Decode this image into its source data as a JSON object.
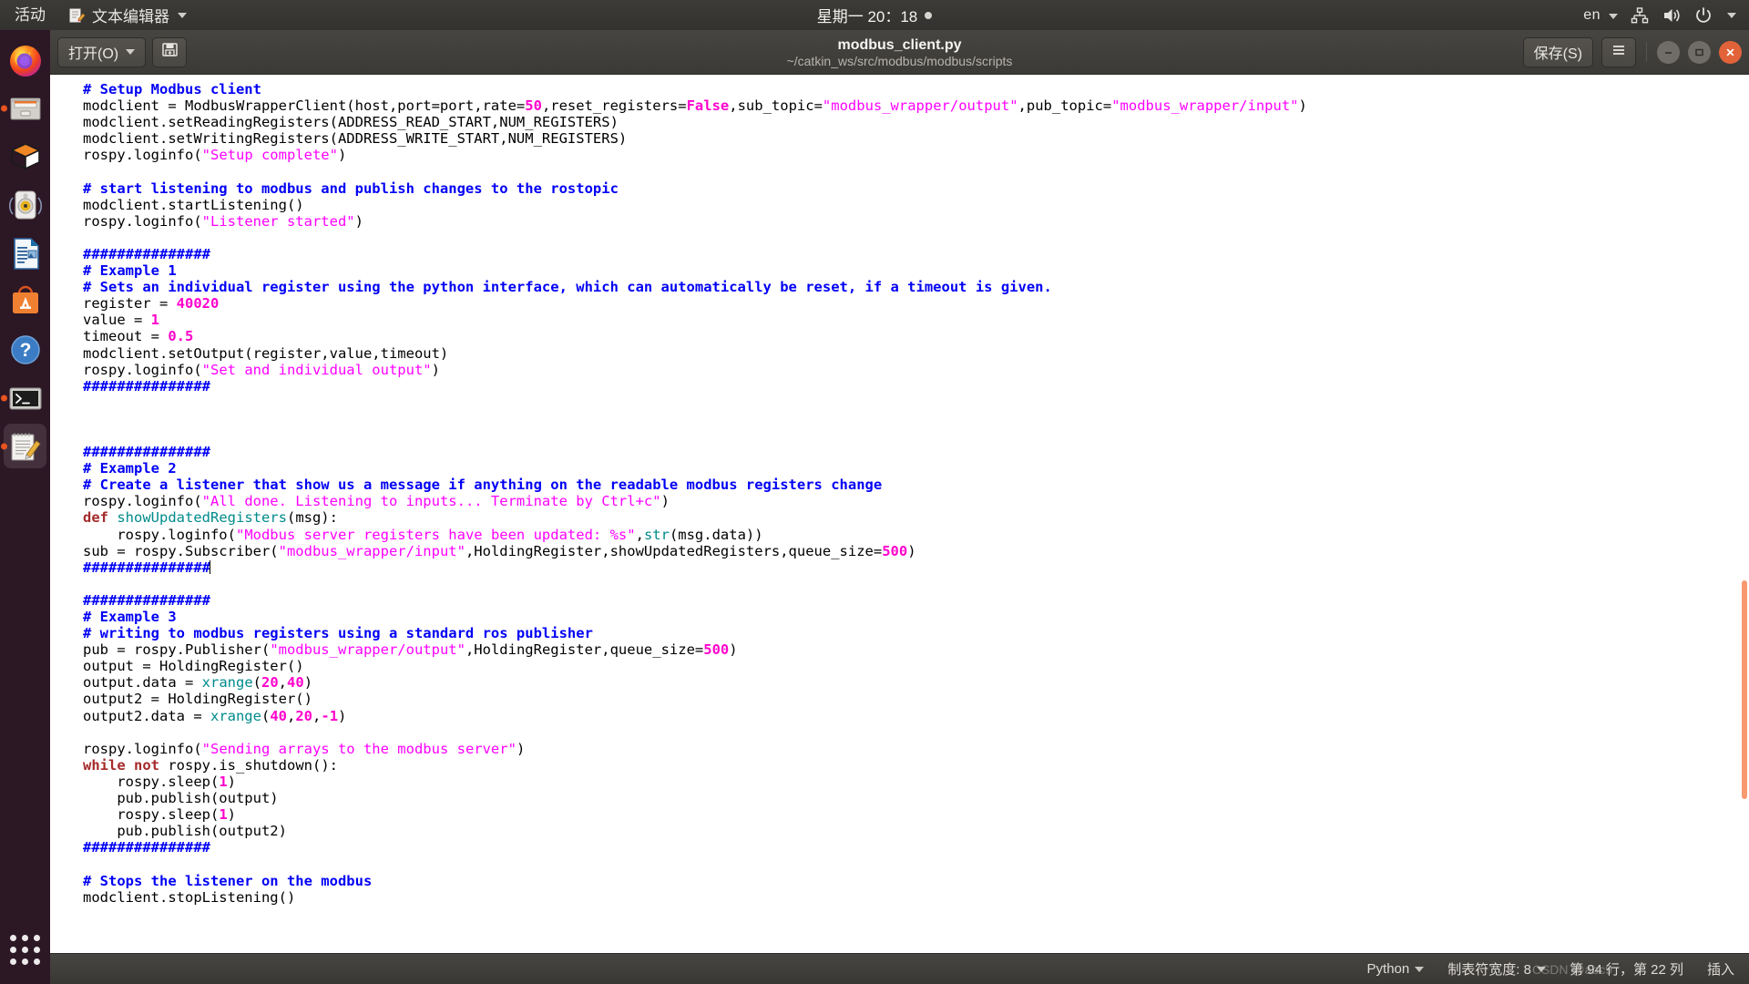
{
  "topbar": {
    "activities": "活动",
    "app_name": "文本编辑器",
    "app_icon": "text-editor-icon",
    "clock": "星期一 20：18",
    "keyboard_layout": "en",
    "icons": [
      "network-icon",
      "volume-icon",
      "power-icon",
      "chevron-down-icon"
    ]
  },
  "dock": {
    "items": [
      {
        "name": "firefox",
        "running": false,
        "active": false
      },
      {
        "name": "files",
        "running": true,
        "active": false
      },
      {
        "name": "ubuntu-software-box",
        "running": false,
        "active": false
      },
      {
        "name": "rhythmbox",
        "running": false,
        "active": false
      },
      {
        "name": "libreoffice-writer",
        "running": false,
        "active": false
      },
      {
        "name": "ubuntu-software",
        "running": false,
        "active": false
      },
      {
        "name": "help",
        "running": false,
        "active": false
      },
      {
        "name": "terminal",
        "running": true,
        "active": false
      },
      {
        "name": "text-editor",
        "running": true,
        "active": true
      }
    ],
    "show_applications": "show-applications-grid"
  },
  "headerbar": {
    "open_label": "打开(O)",
    "save_icon": "save-icon",
    "title": "modbus_client.py",
    "subtitle": "~/catkin_ws/src/modbus/modbus/scripts",
    "save_label": "保存(S)",
    "menu_icon": "hamburger-menu-icon",
    "window_buttons": [
      "minimize",
      "maximize",
      "close"
    ]
  },
  "statusbar": {
    "language": "Python",
    "tab_width": "制表符宽度: 8",
    "cursor_position": "第 94 行，第 22 列",
    "insert_mode": "插入",
    "watermark": "CSDN @abc9"
  },
  "editor": {
    "colors": {
      "comment": "#0000f5",
      "string": "#ff00ff",
      "number": "#ff00cc",
      "keyword": "#a52a2a",
      "function": "#008b8b",
      "background": "#ffffff",
      "accent": "#e95420",
      "scrollbar": "#f79a70"
    },
    "lines": [
      "# Setup Modbus client",
      "modclient = ModbusWrapperClient(host,port=port,rate=50,reset_registers=False,sub_topic=\"modbus_wrapper/output\",pub_topic=\"modbus_wrapper/input\")",
      "modclient.setReadingRegisters(ADDRESS_READ_START,NUM_REGISTERS)",
      "modclient.setWritingRegisters(ADDRESS_WRITE_START,NUM_REGISTERS)",
      "rospy.loginfo(\"Setup complete\")",
      "",
      "# start listening to modbus and publish changes to the rostopic",
      "modclient.startListening()",
      "rospy.loginfo(\"Listener started\")",
      "",
      "###############",
      "# Example 1",
      "# Sets an individual register using the python interface, which can automatically be reset, if a timeout is given.",
      "register = 40020",
      "value = 1",
      "timeout = 0.5",
      "modclient.setOutput(register,value,timeout)",
      "rospy.loginfo(\"Set and individual output\")",
      "###############",
      "",
      "",
      "",
      "###############",
      "# Example 2",
      "# Create a listener that show us a message if anything on the readable modbus registers change",
      "rospy.loginfo(\"All done. Listening to inputs... Terminate by Ctrl+c\")",
      "def showUpdatedRegisters(msg):",
      "    rospy.loginfo(\"Modbus server registers have been updated: %s\",str(msg.data))",
      "sub = rospy.Subscriber(\"modbus_wrapper/input\",HoldingRegister,showUpdatedRegisters,queue_size=500)",
      "###############",
      "",
      "###############",
      "# Example 3",
      "# writing to modbus registers using a standard ros publisher",
      "pub = rospy.Publisher(\"modbus_wrapper/output\",HoldingRegister,queue_size=500)",
      "output = HoldingRegister()",
      "output.data = xrange(20,40)",
      "output2 = HoldingRegister()",
      "output2.data = xrange(40,20,-1)",
      "",
      "rospy.loginfo(\"Sending arrays to the modbus server\")",
      "while not rospy.is_shutdown():",
      "    rospy.sleep(1)",
      "    pub.publish(output)",
      "    rospy.sleep(1)",
      "    pub.publish(output2)",
      "###############",
      "",
      "# Stops the listener on the modbus",
      "modclient.stopListening()"
    ]
  }
}
